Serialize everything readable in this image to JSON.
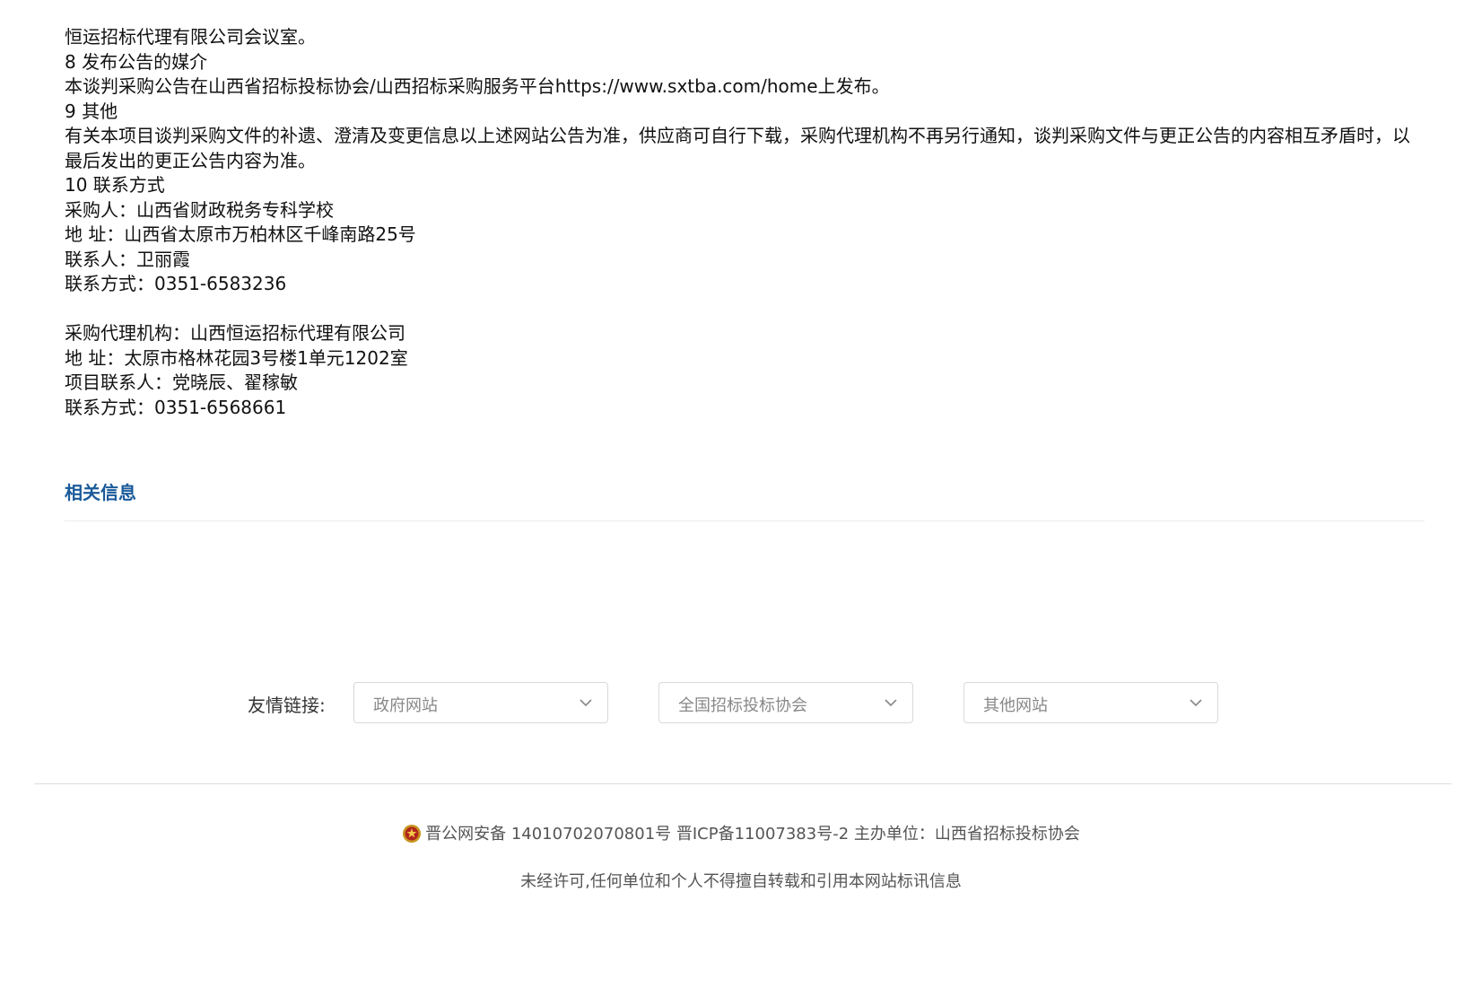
{
  "content": {
    "lines": [
      "恒运招标代理有限公司会议室。",
      "8 发布公告的媒介",
      "本谈判采购公告在山西省招标投标协会/山西招标采购服务平台https://www.sxtba.com/home上发布。",
      "9 其他",
      "有关本项目谈判采购文件的补遗、澄清及变更信息以上述网站公告为准，供应商可自行下载，采购代理机构不再另行通知，谈判采购文件与更正公告的内容相互矛盾时，以最后发出的更正公告内容为准。",
      "10 联系方式",
      "采购人：山西省财政税务专科学校",
      "地 址：山西省太原市万柏林区千峰南路25号",
      "联系人：卫丽霞",
      "联系方式：0351-6583236",
      "采购代理机构：山西恒运招标代理有限公司",
      "地 址：太原市格林花园3号楼1单元1202室",
      "项目联系人：党晓辰、翟稼敏",
      "联系方式：0351-6568661"
    ]
  },
  "related": {
    "title": "相关信息"
  },
  "friendly_links": {
    "label": "友情链接:",
    "selects": [
      {
        "value": "政府网站",
        "icon": "chevron-down-icon"
      },
      {
        "value": "全国招标投标协会",
        "icon": "chevron-down-icon"
      },
      {
        "value": "其他网站",
        "icon": "chevron-down-icon"
      }
    ]
  },
  "footer": {
    "badge_icon": "police-badge-icon",
    "line1": "晋公网安备 14010702070801号 晋ICP备11007383号-2 主办单位：山西省招标投标协会",
    "line2": "未经许可,任何单位和个人不得擅自转载和引用本网站标讯信息"
  },
  "colors": {
    "accent": "#1a5a9a",
    "text": "#111111",
    "muted": "#555555"
  }
}
